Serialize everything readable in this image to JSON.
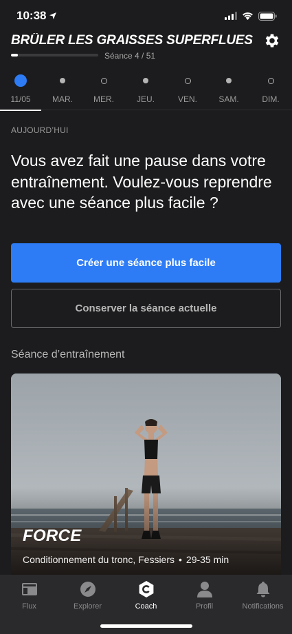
{
  "status_bar": {
    "time": "10:38",
    "icons": [
      "location-arrow-icon",
      "cellular-signal-icon",
      "wifi-icon",
      "battery-icon"
    ]
  },
  "header": {
    "program_title": "BRÛLER LES GRAISSES SUPERFLUES",
    "session_count": "Séance 4 / 51",
    "progress_fraction": 0.078,
    "settings_icon": "gear-icon"
  },
  "days": [
    {
      "label": "11/05",
      "state": "today",
      "active": true
    },
    {
      "label": "MAR.",
      "state": "filled",
      "active": false
    },
    {
      "label": "MER.",
      "state": "ring",
      "active": false
    },
    {
      "label": "JEU.",
      "state": "filled",
      "active": false
    },
    {
      "label": "VEN.",
      "state": "ring",
      "active": false
    },
    {
      "label": "SAM.",
      "state": "filled",
      "active": false
    },
    {
      "label": "DIM.",
      "state": "ring",
      "active": false
    }
  ],
  "main": {
    "today_label": "AUJOURD’HUI",
    "prompt": "Vous avez fait une pause dans votre entraînement. Voulez-vous reprendre avec une séance plus facile ?",
    "primary_button": "Créer une séance plus facile",
    "secondary_button": "Conserver la séance actuelle",
    "section_title": "Séance d’entraînement"
  },
  "workout_card": {
    "type": "FORCE",
    "focus": "Conditionnement du tronc, Fessiers",
    "separator": "•",
    "duration": "29-35 min"
  },
  "tab_bar": {
    "tabs": [
      {
        "label": "Flux",
        "icon": "feed-icon",
        "active": false
      },
      {
        "label": "Explorer",
        "icon": "compass-icon",
        "active": false
      },
      {
        "label": "Coach",
        "icon": "coach-icon",
        "active": true
      },
      {
        "label": "Profil",
        "icon": "profile-icon",
        "active": false
      },
      {
        "label": "Notifications",
        "icon": "bell-icon",
        "active": false
      }
    ]
  },
  "colors": {
    "background": "#1c1c1e",
    "accent": "#2d7cf6",
    "tab_bar": "#2a2a2c"
  }
}
